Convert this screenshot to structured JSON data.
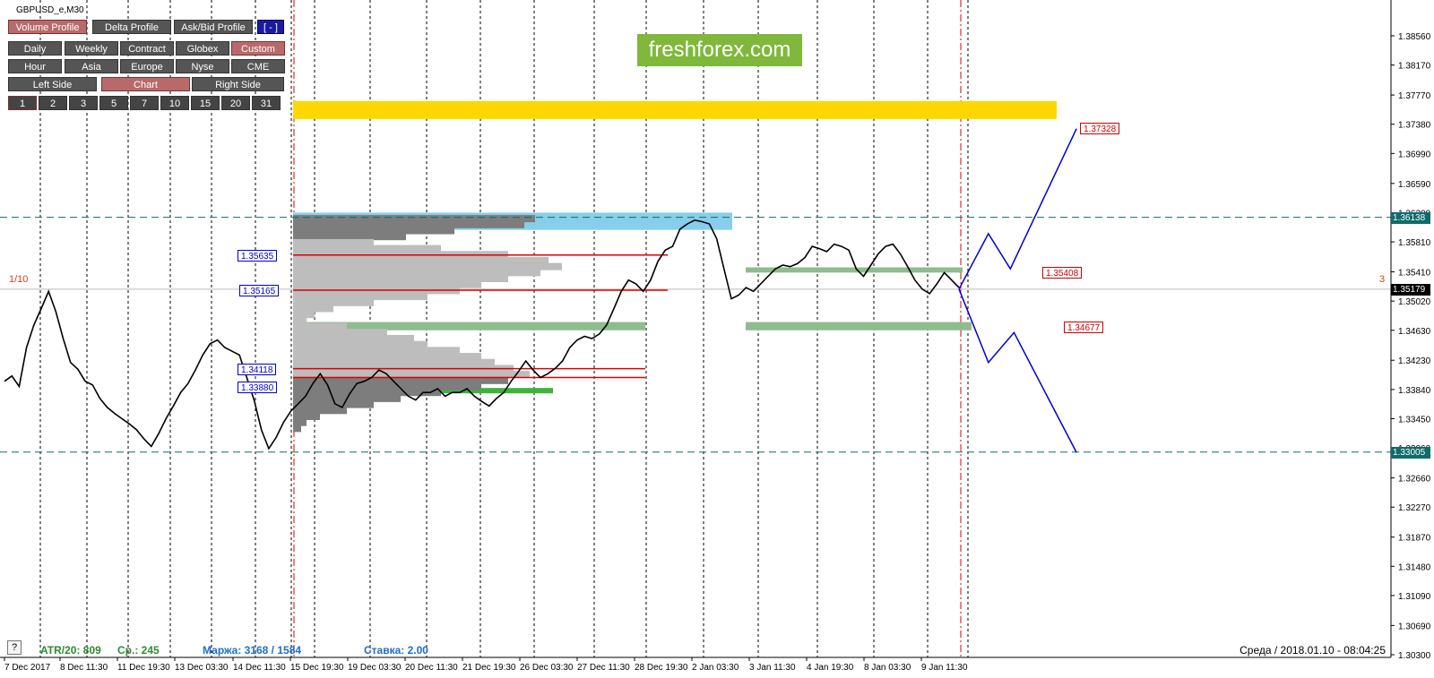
{
  "symbol": "GBPUSD_e,M30",
  "watermark": "freshforex.com",
  "panel": {
    "row1": [
      {
        "label": "Volume Profile",
        "active": true
      },
      {
        "label": "Delta Profile",
        "active": false
      },
      {
        "label": "Ask/Bid Profile",
        "active": false
      },
      {
        "label": "[ - ]",
        "active": false
      }
    ],
    "row2": [
      {
        "label": "Daily",
        "active": false
      },
      {
        "label": "Weekly",
        "active": false
      },
      {
        "label": "Contract",
        "active": false
      },
      {
        "label": "Globex",
        "active": false
      },
      {
        "label": "Custom",
        "active": true
      }
    ],
    "row3": [
      {
        "label": "Hour",
        "active": false
      },
      {
        "label": "Asia",
        "active": false
      },
      {
        "label": "Europe",
        "active": false
      },
      {
        "label": "Nyse",
        "active": false
      },
      {
        "label": "CME",
        "active": false
      }
    ],
    "row4": [
      {
        "label": "Left Side",
        "active": false
      },
      {
        "label": "Chart",
        "active": true
      },
      {
        "label": "Right Side",
        "active": false
      }
    ],
    "row5": [
      {
        "label": "1",
        "active": true
      },
      {
        "label": "2",
        "active": false
      },
      {
        "label": "3",
        "active": false
      },
      {
        "label": "5",
        "active": false
      },
      {
        "label": "7",
        "active": false
      },
      {
        "label": "10",
        "active": false
      },
      {
        "label": "15",
        "active": false
      },
      {
        "label": "20",
        "active": false
      },
      {
        "label": "31",
        "active": false
      }
    ]
  },
  "price_axis": [
    "1.38560",
    "1.38170",
    "1.37770",
    "1.37380",
    "1.36990",
    "1.36590",
    "1.36200",
    "1.35810",
    "1.35410",
    "1.35020",
    "1.34630",
    "1.34230",
    "1.33840",
    "1.33450",
    "1.33060",
    "1.32660",
    "1.32270",
    "1.31870",
    "1.31480",
    "1.31090",
    "1.30690",
    "1.30300"
  ],
  "current_price": "1.35179",
  "resistance_level": "1.36138",
  "support_level": "1.33005",
  "level_labels_left": [
    "1.35635",
    "1.35165",
    "1.34118",
    "1.33880"
  ],
  "level_labels_right": [
    "1.37328",
    "1.35408",
    "1.34677"
  ],
  "time_axis": [
    "7 Dec 2017",
    "8 Dec 11:30",
    "11 Dec 19:30",
    "13 Dec 03:30",
    "14 Dec 11:30",
    "15 Dec 19:30",
    "19 Dec 03:30",
    "20 Dec 11:30",
    "21 Dec 19:30",
    "26 Dec 03:30",
    "27 Dec 11:30",
    "28 Dec 19:30",
    "2 Jan 03:30",
    "3 Jan 11:30",
    "4 Jan 19:30",
    "8 Jan 03:30",
    "9 Jan 11:30"
  ],
  "fraction_label": "1/10",
  "right_number": "3",
  "stats": {
    "atr": "ATR/20: 809",
    "avg": "Ср.: 245",
    "margin": "Маржа: 3168 / 1584",
    "rate": "Ставка: 2.00"
  },
  "help_button": "?",
  "datetime": "Среда  /  2018.01.10  -  08:04:25",
  "colors": {
    "yellow_zone": "#ffd700",
    "blue_zone": "#87ceeb",
    "green_zone": "#8fbc8f",
    "forecast_line": "#0000cc",
    "red_line": "#dd0000"
  },
  "chart_data": {
    "type": "line",
    "ylim": [
      1.303,
      1.3856
    ],
    "price_path": [
      [
        0,
        1.3395
      ],
      [
        2,
        1.3402
      ],
      [
        4,
        1.3388
      ],
      [
        6,
        1.344
      ],
      [
        8,
        1.347
      ],
      [
        10,
        1.3492
      ],
      [
        12,
        1.3515
      ],
      [
        14,
        1.3488
      ],
      [
        16,
        1.3452
      ],
      [
        18,
        1.342
      ],
      [
        20,
        1.3411
      ],
      [
        22,
        1.3395
      ],
      [
        24,
        1.339
      ],
      [
        26,
        1.3372
      ],
      [
        28,
        1.336
      ],
      [
        30,
        1.3352
      ],
      [
        32,
        1.3345
      ],
      [
        34,
        1.3338
      ],
      [
        36,
        1.333
      ],
      [
        38,
        1.3318
      ],
      [
        40,
        1.3308
      ],
      [
        42,
        1.3325
      ],
      [
        44,
        1.3345
      ],
      [
        46,
        1.3362
      ],
      [
        48,
        1.338
      ],
      [
        50,
        1.3392
      ],
      [
        52,
        1.341
      ],
      [
        54,
        1.343
      ],
      [
        56,
        1.3445
      ],
      [
        58,
        1.345
      ],
      [
        60,
        1.344
      ],
      [
        62,
        1.3435
      ],
      [
        64,
        1.343
      ],
      [
        66,
        1.34
      ],
      [
        68,
        1.337
      ],
      [
        70,
        1.333
      ],
      [
        72,
        1.3305
      ],
      [
        74,
        1.332
      ],
      [
        76,
        1.334
      ],
      [
        78,
        1.3355
      ],
      [
        80,
        1.3365
      ],
      [
        82,
        1.3375
      ],
      [
        84,
        1.3392
      ],
      [
        86,
        1.3405
      ],
      [
        88,
        1.339
      ],
      [
        90,
        1.3365
      ],
      [
        92,
        1.336
      ],
      [
        94,
        1.3378
      ],
      [
        96,
        1.3392
      ],
      [
        98,
        1.3395
      ],
      [
        100,
        1.34
      ],
      [
        102,
        1.341
      ],
      [
        104,
        1.3405
      ],
      [
        106,
        1.3395
      ],
      [
        108,
        1.3385
      ],
      [
        110,
        1.3375
      ],
      [
        112,
        1.337
      ],
      [
        114,
        1.338
      ],
      [
        116,
        1.338
      ],
      [
        118,
        1.3385
      ],
      [
        120,
        1.3375
      ],
      [
        122,
        1.338
      ],
      [
        124,
        1.338
      ],
      [
        126,
        1.3385
      ],
      [
        128,
        1.3375
      ],
      [
        130,
        1.3368
      ],
      [
        132,
        1.3362
      ],
      [
        134,
        1.3372
      ],
      [
        136,
        1.338
      ],
      [
        138,
        1.3395
      ],
      [
        140,
        1.3408
      ],
      [
        142,
        1.3422
      ],
      [
        144,
        1.341
      ],
      [
        146,
        1.34
      ],
      [
        148,
        1.3405
      ],
      [
        150,
        1.3412
      ],
      [
        152,
        1.3422
      ],
      [
        154,
        1.344
      ],
      [
        156,
        1.345
      ],
      [
        158,
        1.3455
      ],
      [
        160,
        1.3452
      ],
      [
        162,
        1.3458
      ],
      [
        164,
        1.347
      ],
      [
        166,
        1.3492
      ],
      [
        168,
        1.3515
      ],
      [
        170,
        1.353
      ],
      [
        172,
        1.3525
      ],
      [
        174,
        1.3515
      ],
      [
        176,
        1.353
      ],
      [
        178,
        1.3555
      ],
      [
        180,
        1.357
      ],
      [
        182,
        1.3575
      ],
      [
        184,
        1.3598
      ],
      [
        186,
        1.3605
      ],
      [
        188,
        1.361
      ],
      [
        190,
        1.3608
      ],
      [
        192,
        1.3605
      ],
      [
        194,
        1.3585
      ],
      [
        196,
        1.3545
      ],
      [
        198,
        1.3505
      ],
      [
        200,
        1.351
      ],
      [
        202,
        1.352
      ],
      [
        204,
        1.3515
      ],
      [
        206,
        1.3525
      ],
      [
        208,
        1.3535
      ],
      [
        210,
        1.3545
      ],
      [
        212,
        1.355
      ],
      [
        214,
        1.3548
      ],
      [
        216,
        1.3552
      ],
      [
        218,
        1.356
      ],
      [
        220,
        1.3575
      ],
      [
        222,
        1.3572
      ],
      [
        224,
        1.3568
      ],
      [
        226,
        1.3578
      ],
      [
        228,
        1.3575
      ],
      [
        230,
        1.357
      ],
      [
        232,
        1.3545
      ],
      [
        234,
        1.3535
      ],
      [
        236,
        1.355
      ],
      [
        238,
        1.3565
      ],
      [
        240,
        1.3575
      ],
      [
        242,
        1.3578
      ],
      [
        244,
        1.3565
      ],
      [
        246,
        1.3548
      ],
      [
        248,
        1.353
      ],
      [
        250,
        1.3518
      ],
      [
        252,
        1.3512
      ],
      [
        254,
        1.3525
      ],
      [
        256,
        1.354
      ],
      [
        258,
        1.353
      ],
      [
        260,
        1.352
      ]
    ],
    "forecast_up": [
      [
        260,
        1.35179
      ],
      [
        268,
        1.3592
      ],
      [
        274,
        1.3545
      ],
      [
        292,
        1.3732
      ]
    ],
    "forecast_down": [
      [
        260,
        1.35179
      ],
      [
        268,
        1.342
      ],
      [
        275,
        1.346
      ],
      [
        292,
        1.33
      ]
    ],
    "volume_profile": [
      [
        1.3612,
        0.9
      ],
      [
        1.3604,
        0.86
      ],
      [
        1.3596,
        0.6
      ],
      [
        1.3588,
        0.42
      ],
      [
        1.358,
        0.3
      ],
      [
        1.3572,
        0.55
      ],
      [
        1.3564,
        0.8
      ],
      [
        1.3556,
        0.95
      ],
      [
        1.3548,
        1.0
      ],
      [
        1.354,
        0.92
      ],
      [
        1.3532,
        0.8
      ],
      [
        1.3524,
        0.7
      ],
      [
        1.3516,
        0.62
      ],
      [
        1.3508,
        0.5
      ],
      [
        1.35,
        0.3
      ],
      [
        1.3492,
        0.15
      ],
      [
        1.3484,
        0.08
      ],
      [
        1.3476,
        0.05
      ],
      [
        1.3468,
        0.2
      ],
      [
        1.346,
        0.35
      ],
      [
        1.3452,
        0.45
      ],
      [
        1.3444,
        0.5
      ],
      [
        1.3436,
        0.62
      ],
      [
        1.3428,
        0.7
      ],
      [
        1.342,
        0.75
      ],
      [
        1.3412,
        0.82
      ],
      [
        1.3404,
        0.88
      ],
      [
        1.3396,
        0.8
      ],
      [
        1.3388,
        0.7
      ],
      [
        1.338,
        0.55
      ],
      [
        1.3372,
        0.4
      ],
      [
        1.3364,
        0.3
      ],
      [
        1.3356,
        0.2
      ],
      [
        1.3348,
        0.1
      ],
      [
        1.334,
        0.05
      ],
      [
        1.3332,
        0.03
      ]
    ],
    "zones": {
      "yellow": [
        1.3745,
        1.3769
      ],
      "blue": [
        1.3597,
        1.362
      ],
      "green_top": [
        1.354,
        1.3547
      ],
      "green_mid": [
        1.3463,
        1.3474
      ],
      "green_right": [
        1.3463,
        1.3474
      ]
    },
    "red_lines": [
      1.35635,
      1.35165,
      1.34118,
      1.34
    ],
    "vline_dates_x": [
      45,
      97,
      143,
      190,
      236,
      285,
      325,
      351,
      413,
      476,
      536,
      596,
      663,
      721,
      785,
      846,
      912,
      975,
      1035,
      1080
    ]
  }
}
